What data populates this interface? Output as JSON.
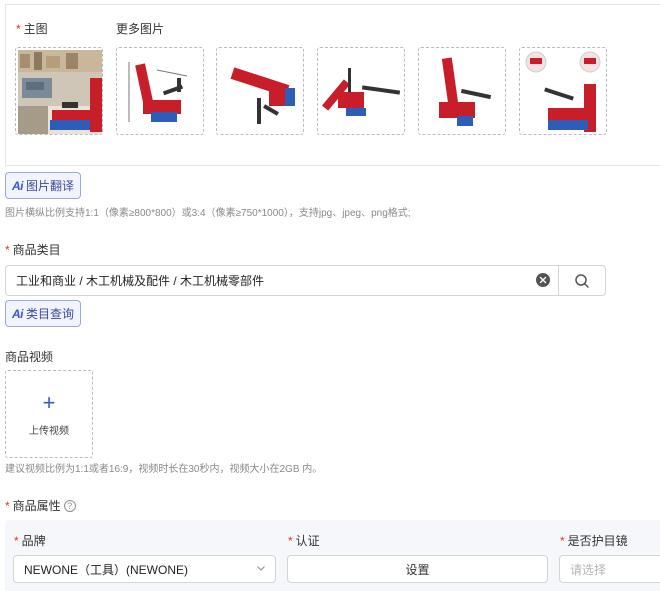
{
  "images": {
    "main_label": "主图",
    "more_label": "更多图片",
    "thumbnails": [
      "main-product-photo",
      "product-photo-2",
      "product-photo-3",
      "product-photo-4",
      "product-photo-5",
      "product-photo-6"
    ]
  },
  "ai_translate": {
    "ai_mark": "Ai",
    "label": "图片翻译"
  },
  "image_hint": "图片横纵比例支持1:1（像素≥800*800）或3:4（像素≥750*1000），支持jpg、jpeg、png格式;",
  "category": {
    "label": "商品类目",
    "value": "工业和商业 / 木工机械及配件 / 木工机械零部件",
    "ai_mark": "Ai",
    "query_label": "类目查询"
  },
  "video": {
    "label": "商品视频",
    "upload_label": "上传视频",
    "hint": "建议视频比例为1:1或者16:9，视频时长在30秒内，视频大小在2GB 内。"
  },
  "attributes": {
    "label": "商品属性",
    "brand": {
      "label": "品牌",
      "value": "NEWONE（工具）(NEWONE)"
    },
    "certification": {
      "label": "认证",
      "button": "设置"
    },
    "goggles": {
      "label": "是否护目镜",
      "placeholder": "请选择"
    }
  },
  "colors": {
    "accent": "#3a57d8",
    "required": "#e0352b",
    "product_red": "#c81e2a",
    "product_blue": "#2d5db8"
  }
}
